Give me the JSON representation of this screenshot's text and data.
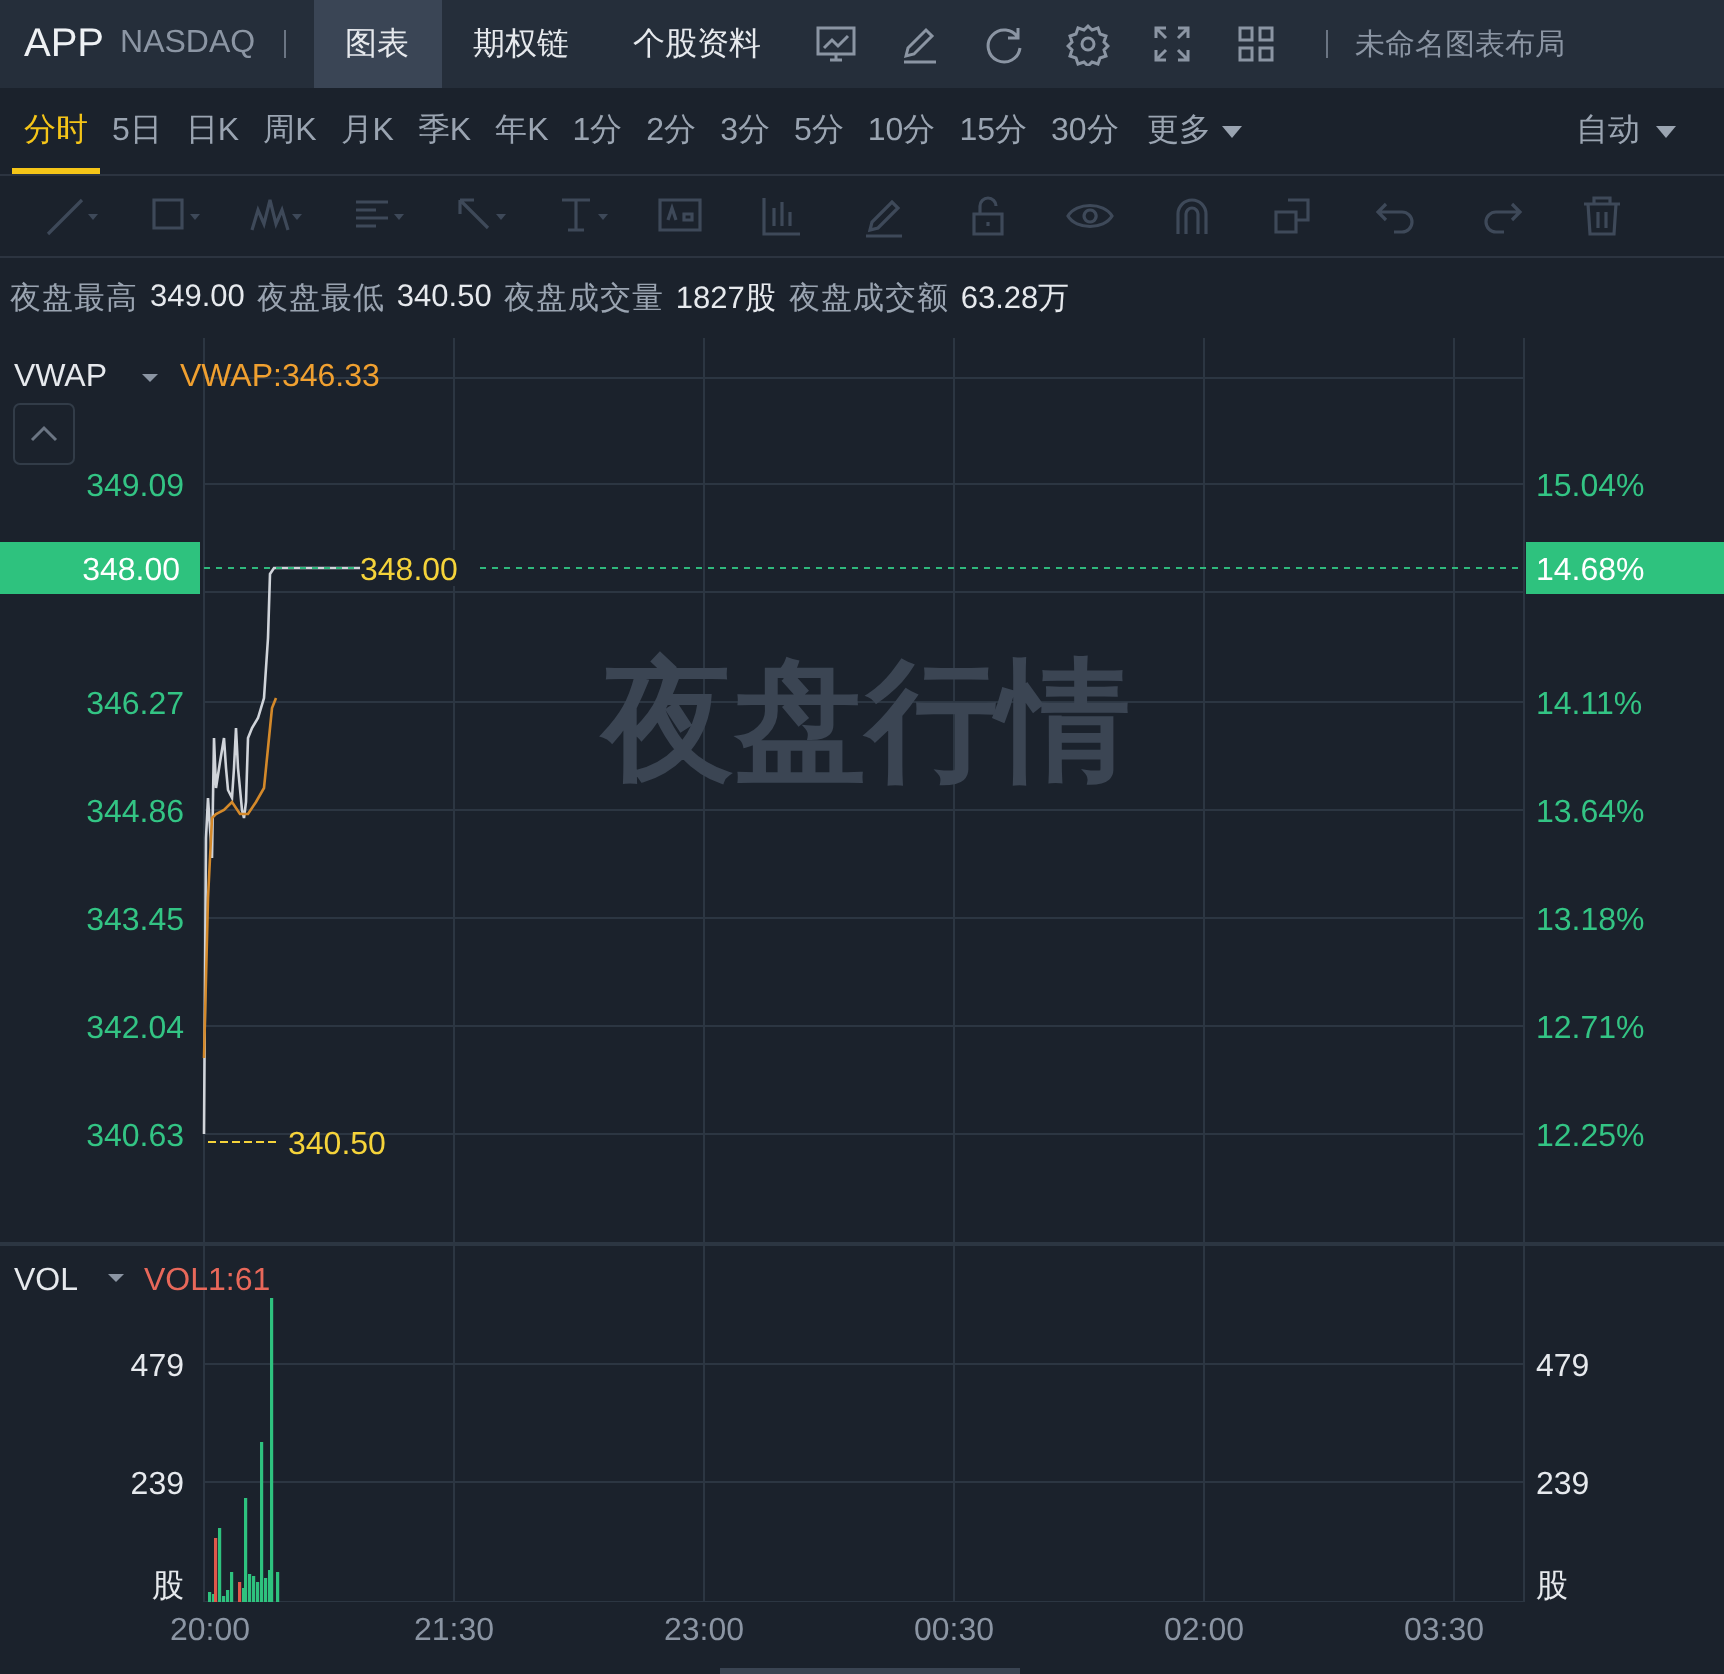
{
  "header": {
    "symbol": "APP",
    "exchange": "NASDAQ",
    "tabs": [
      {
        "label": "图表",
        "selected": true
      },
      {
        "label": "期权链",
        "selected": false
      },
      {
        "label": "个股资料",
        "selected": false
      }
    ],
    "layout_name": "未命名图表布局"
  },
  "periods": [
    {
      "label": "分时",
      "selected": true
    },
    {
      "label": "5日",
      "selected": false
    },
    {
      "label": "日K",
      "selected": false
    },
    {
      "label": "周K",
      "selected": false
    },
    {
      "label": "月K",
      "selected": false
    },
    {
      "label": "季K",
      "selected": false
    },
    {
      "label": "年K",
      "selected": false
    },
    {
      "label": "1分",
      "selected": false
    },
    {
      "label": "2分",
      "selected": false
    },
    {
      "label": "3分",
      "selected": false
    },
    {
      "label": "5分",
      "selected": false
    },
    {
      "label": "10分",
      "selected": false
    },
    {
      "label": "15分",
      "selected": false
    },
    {
      "label": "30分",
      "selected": false
    }
  ],
  "more": "更多",
  "scale_mode": "自动",
  "stats": [
    {
      "label": "夜盘最高",
      "value": "349.00"
    },
    {
      "label": "夜盘最低",
      "value": "340.50"
    },
    {
      "label": "夜盘成交量",
      "value": "1827股"
    },
    {
      "label": "夜盘成交额",
      "value": "63.28万"
    }
  ],
  "price_panel": {
    "indicator": "VWAP",
    "indicator_value": "VWAP:346.33",
    "watermark": "夜盘行情",
    "price_ticks": [
      "349.09",
      "346.27",
      "344.86",
      "343.45",
      "342.04",
      "340.63"
    ],
    "percent_ticks": [
      "15.04%",
      "14.11%",
      "13.64%",
      "13.18%",
      "12.71%",
      "12.25%"
    ],
    "current_price": "348.00",
    "current_percent": "14.68%",
    "high_marker": "348.00",
    "low_marker": "340.50"
  },
  "volume_panel": {
    "indicator": "VOL",
    "indicator_value": "VOL1:61",
    "left_ticks": [
      "479",
      "239",
      "股"
    ],
    "right_ticks": [
      "479",
      "239",
      "股"
    ]
  },
  "time_labels": [
    "20:00",
    "21:30",
    "23:00",
    "00:30",
    "02:00",
    "03:30"
  ]
}
